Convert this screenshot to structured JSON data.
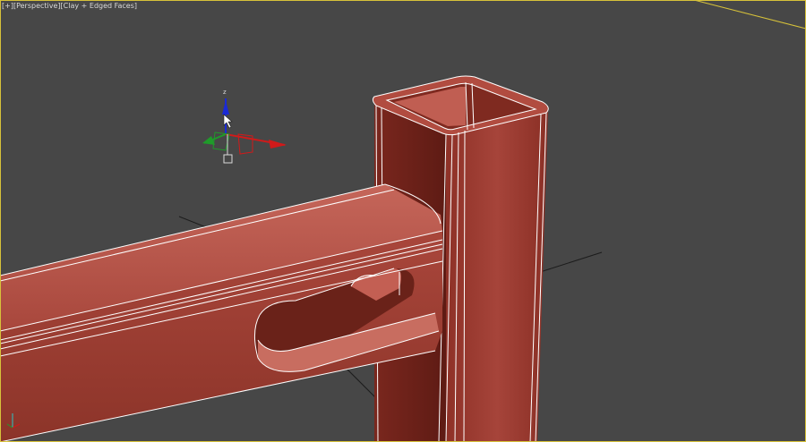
{
  "viewport": {
    "menu_plus": "[+]",
    "view": "[Perspective]",
    "shading": "[Clay + Edged Faces]"
  },
  "gizmo": {
    "z_label": "z",
    "x_color": "#d01a1a",
    "y_color": "#1f9b2a",
    "z_color": "#1a2ad6"
  },
  "colors": {
    "background": "#474747",
    "clay_light": "#b3544a",
    "clay_mid": "#9a3e33",
    "clay_dark": "#6e241b",
    "wire": "#ffffff",
    "active_border": "#d7c23a"
  }
}
